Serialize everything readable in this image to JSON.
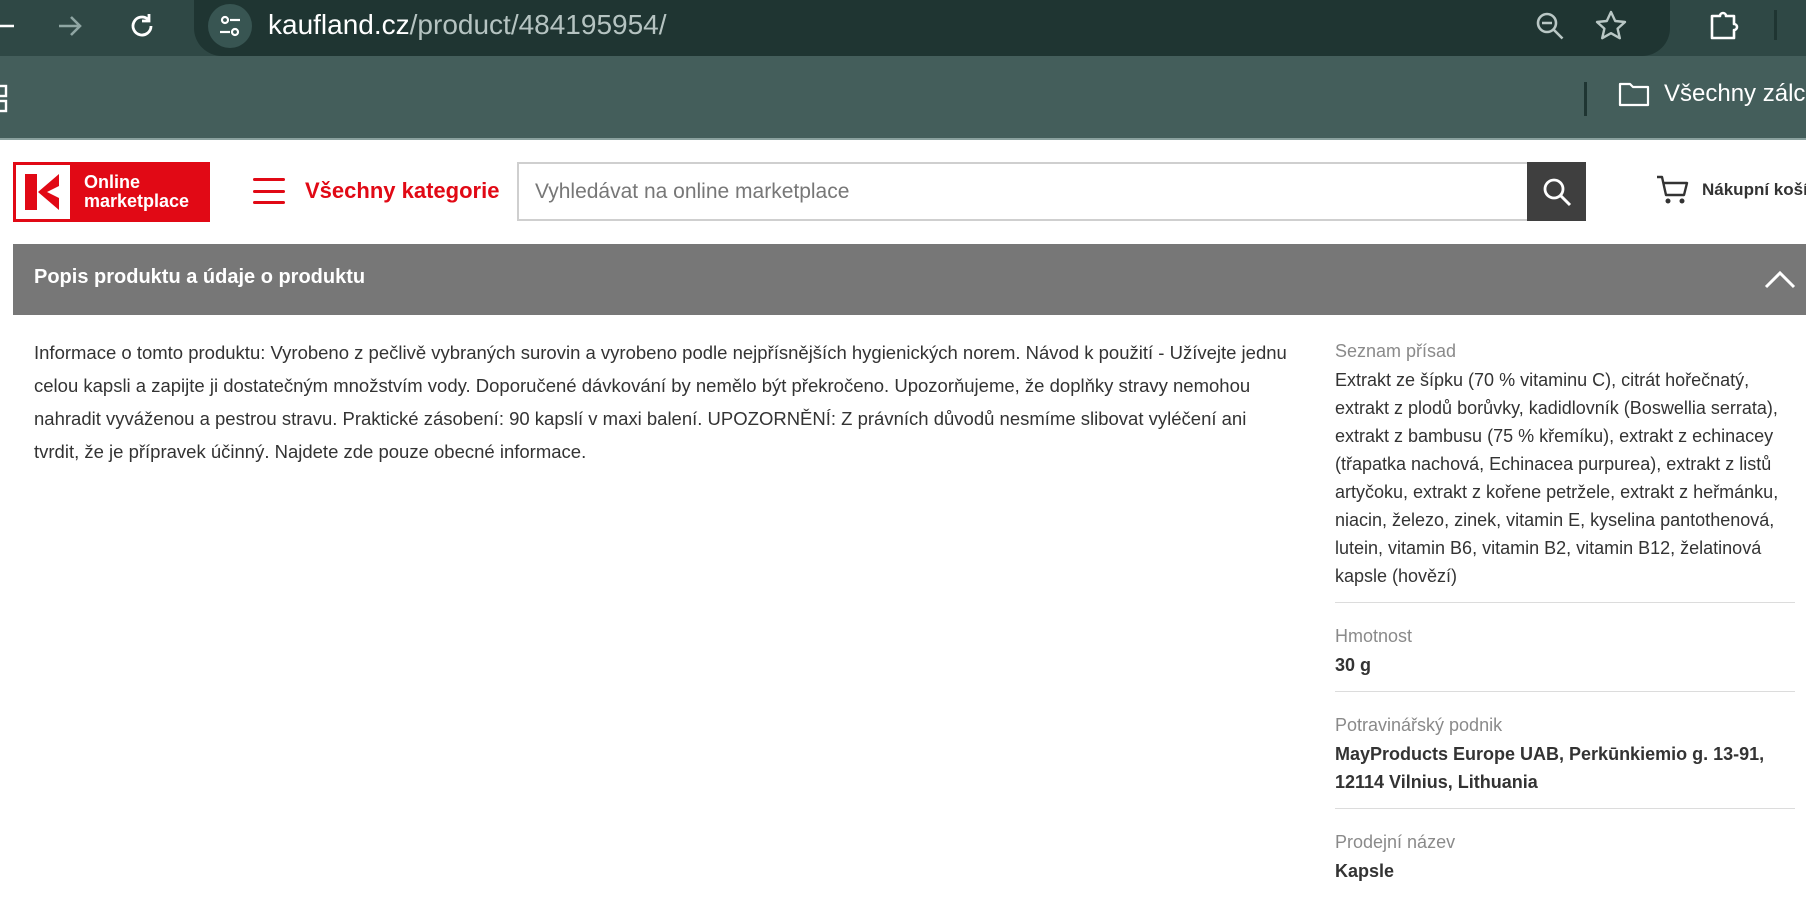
{
  "browser": {
    "url_host": "kaufland.cz",
    "url_path": "/product/484195954/",
    "bookmarks_folder": "Všechny zálc"
  },
  "header": {
    "logo_line1": "Online",
    "logo_line2": "marketplace",
    "categories_label": "Všechny kategorie",
    "search_placeholder": "Vyhledávat na online marketplace",
    "cart_label": "Nákupní koší",
    "brand_color": "#e10915"
  },
  "section": {
    "title": "Popis produktu a údaje o produktu"
  },
  "description": {
    "text": "Informace o tomto produktu: Vyrobeno z pečlivě vybraných surovin a vyrobeno podle nejpřísnějších hygienických norem. Návod k použití - Užívejte jednu celou kapsli a zapijte ji dostatečným množstvím vody. Doporučené dávkování by nemělo být překročeno. Upozorňujeme, že doplňky stravy nemohou nahradit vyváženou a pestrou stravu. Praktické zásobení: 90 kapslí v maxi balení. UPOZORNĚNÍ: Z právních důvodů nesmíme slibovat vyléčení ani tvrdit, že je přípravek účinný. Najdete zde pouze obecné informace."
  },
  "attributes": [
    {
      "label": "Seznam přísad",
      "value": "Extrakt ze šípku (70 % vitaminu C), citrát hořečnatý, extrakt z plodů borůvky, kadidlovník (Boswellia serrata), extrakt z bambusu (75 % křemíku), extrakt z echinacey (třapatka nachová, Echinacea purpurea), extrakt z listů artyčoku, extrakt z kořene petržele, extrakt z heřmánku, niacin, železo, zinek, vitamin E, kyselina pantothenová, lutein, vitamin B6, vitamin B2, vitamin B12, želatinová kapsle (hovězí)"
    },
    {
      "label": "Hmotnost",
      "value": "30 g"
    },
    {
      "label": "Potravinářský podnik",
      "value": "MayProducts Europe UAB, Perkūnkiemio g. 13-91, 12114 Vilnius, Lithuania"
    },
    {
      "label": "Prodejní název",
      "value": "Kapsle"
    }
  ]
}
